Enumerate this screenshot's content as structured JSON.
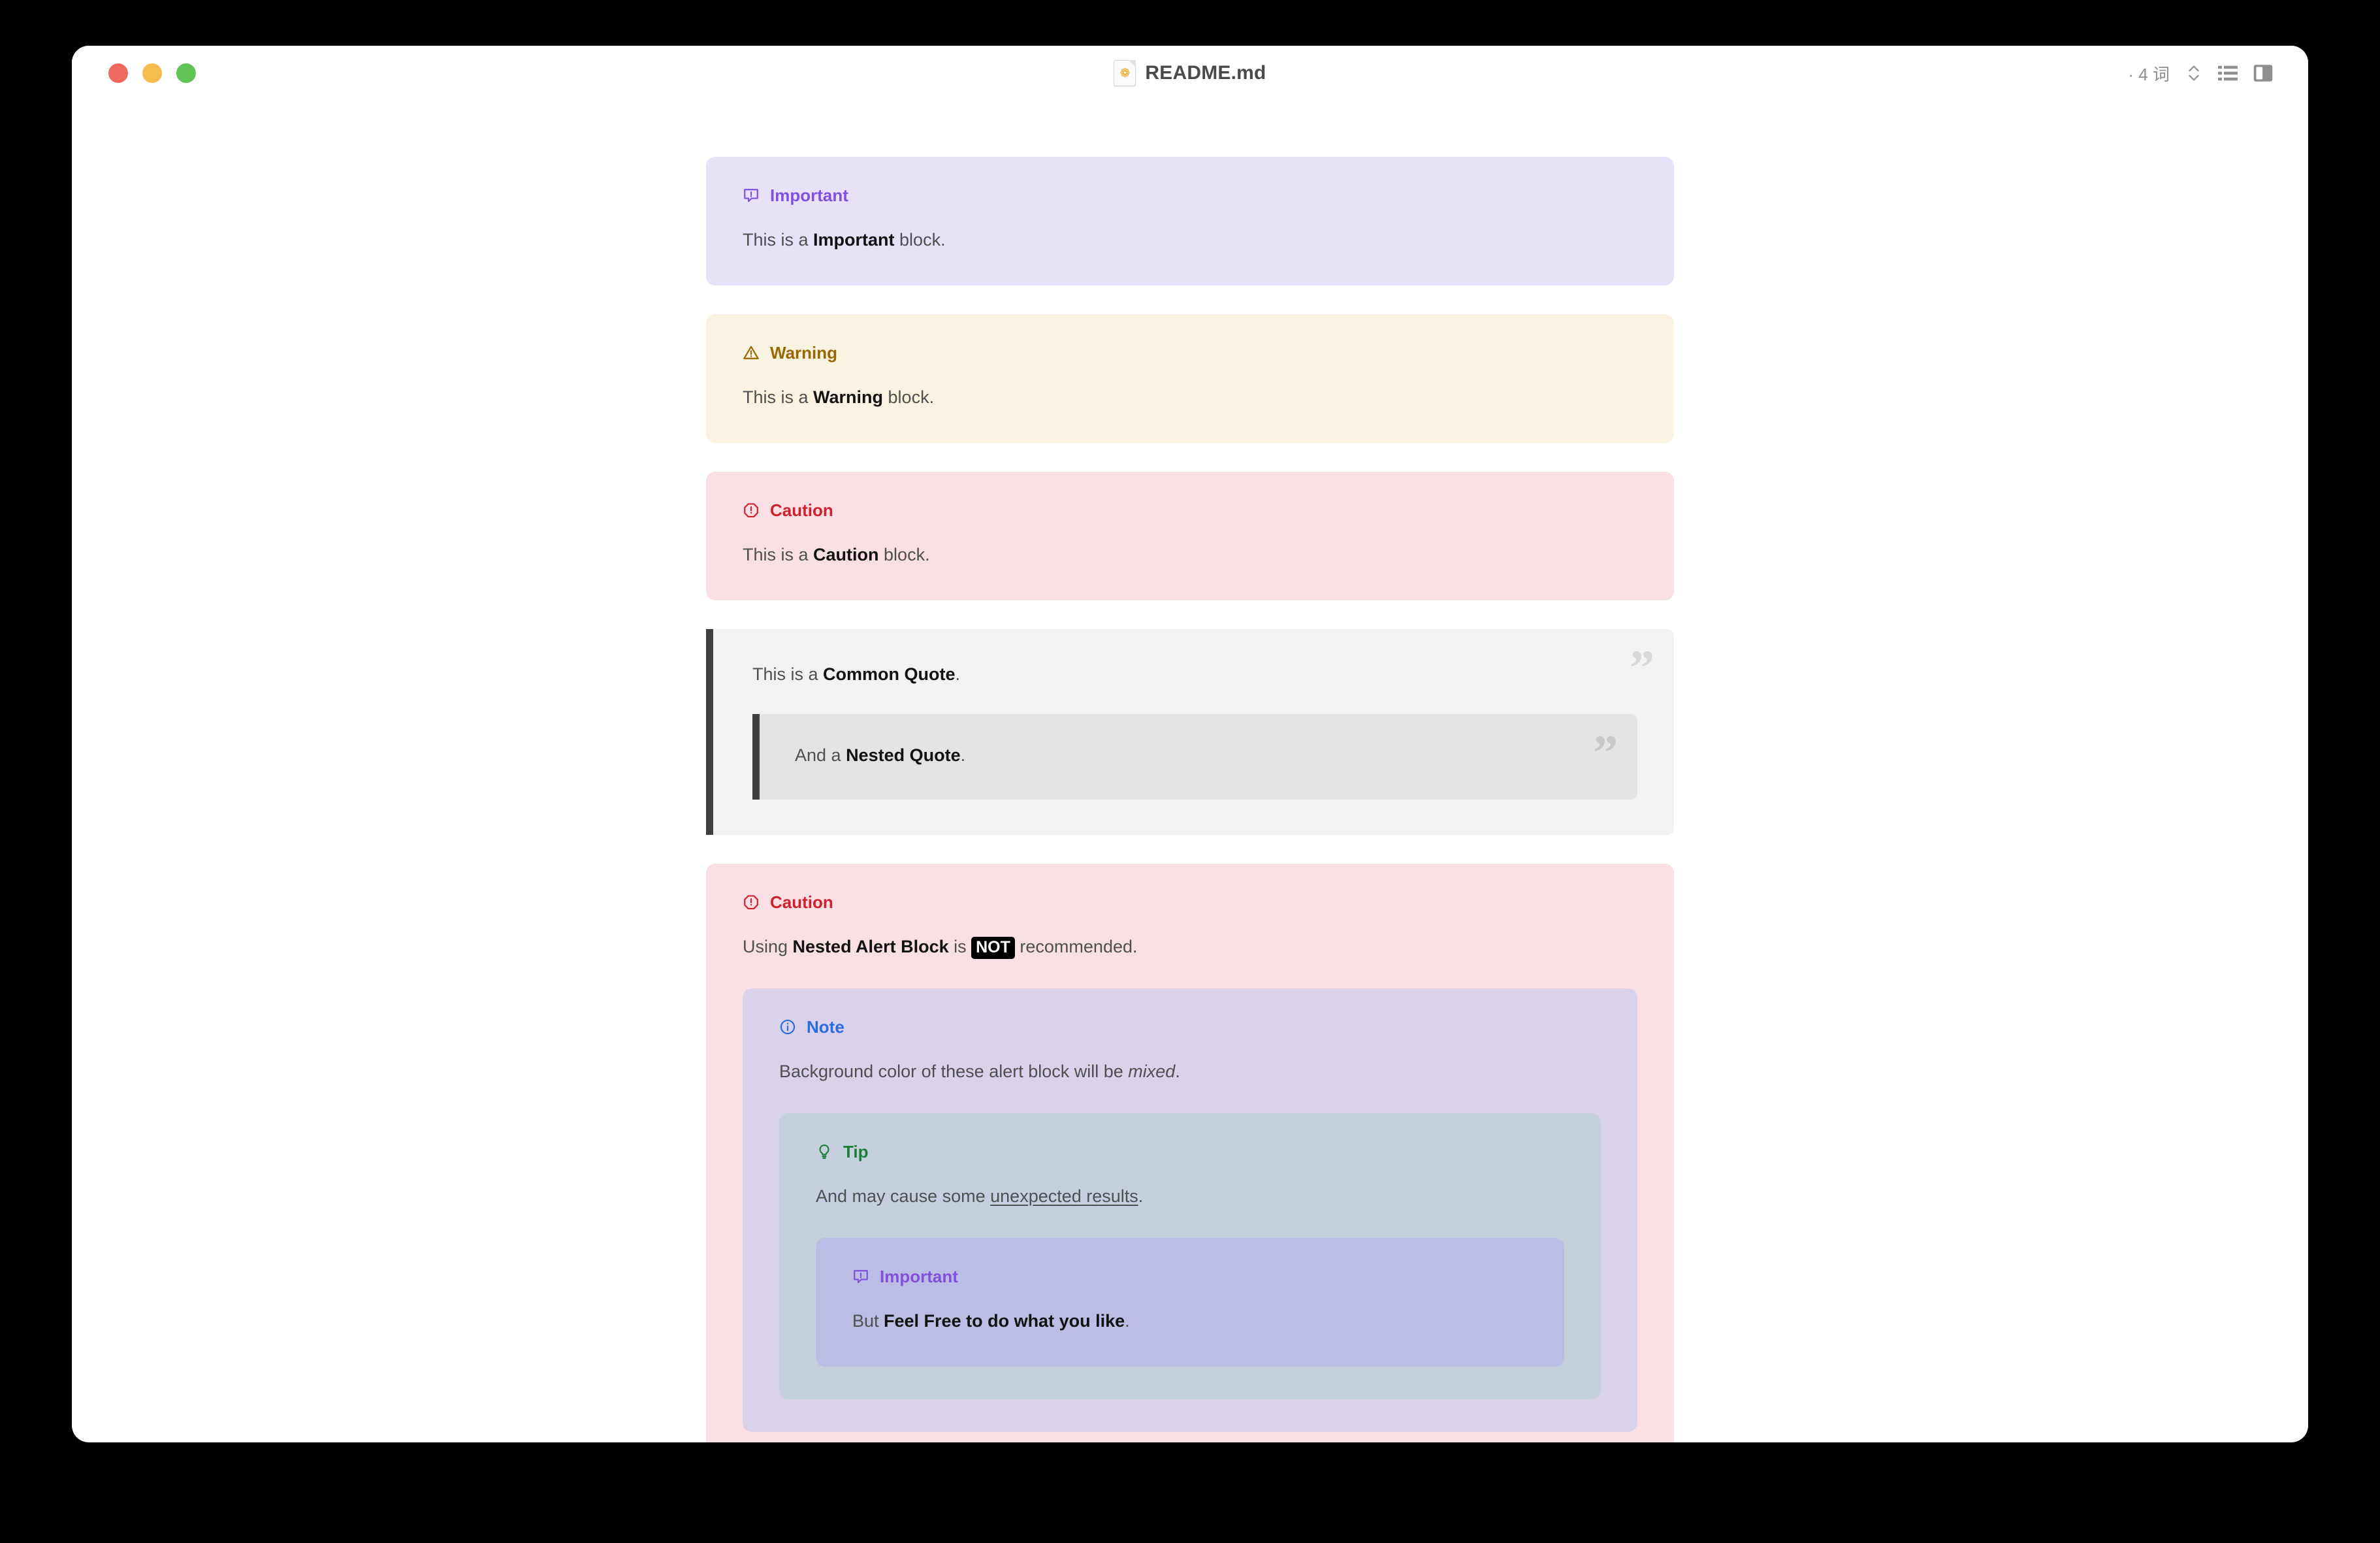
{
  "window": {
    "title": "README.md",
    "doc_icon_glyph": "❁",
    "traffic_lights": [
      "close",
      "minimize",
      "maximize"
    ]
  },
  "toolbar": {
    "word_count": "· 4 词",
    "sort_icon": "chevron-up-down-icon",
    "outline_icon": "list-icon",
    "sidebar_icon": "sidebar-toggle-icon"
  },
  "blocks": {
    "important": {
      "label": "Important",
      "icon": "message-alert-icon",
      "color": "#8250df",
      "bg": "#e7e2f8",
      "body_pre": "This is a ",
      "body_strong": "Important",
      "body_post": " block."
    },
    "warning": {
      "label": "Warning",
      "icon": "triangle-alert-icon",
      "color": "#9a6700",
      "bg": "#faf3e2",
      "body_pre": "This is a ",
      "body_strong": "Warning",
      "body_post": " block."
    },
    "caution": {
      "label": "Caution",
      "icon": "octagon-alert-icon",
      "color": "#cf222e",
      "bg": "#fae0e4",
      "body_pre": "This is a ",
      "body_strong": "Caution",
      "body_post": " block."
    },
    "quote": {
      "mark": "”",
      "body_pre": "This is a ",
      "body_strong": "Common Quote",
      "body_post": ".",
      "nested": {
        "mark": "”",
        "body_pre": "And a ",
        "body_strong": "Nested Quote",
        "body_post": "."
      }
    },
    "caution_nested": {
      "label": "Caution",
      "icon": "octagon-alert-icon",
      "color": "#cf222e",
      "bg": "#fae0e4",
      "body_pre": "Using ",
      "body_strong": "Nested Alert Block",
      "body_mid": " is ",
      "body_code": "NOT",
      "body_post": " recommended."
    },
    "note": {
      "label": "Note",
      "icon": "info-circle-icon",
      "color": "#2b6cdf",
      "bg": "#dad2ea",
      "body_pre": "Background color of these alert block will be ",
      "body_em": "mixed",
      "body_post": "."
    },
    "tip": {
      "label": "Tip",
      "icon": "lightbulb-icon",
      "color": "#1a7f37",
      "bg": "#c5cfde",
      "body_pre": "And may cause some ",
      "body_underline": "unexpected results",
      "body_post": "."
    },
    "important_inner": {
      "label": "Important",
      "icon": "message-alert-icon",
      "color": "#8250df",
      "bg": "#bcbde4",
      "body_pre": "But ",
      "body_strong": "Feel Free to do what you like",
      "body_post": "."
    }
  }
}
